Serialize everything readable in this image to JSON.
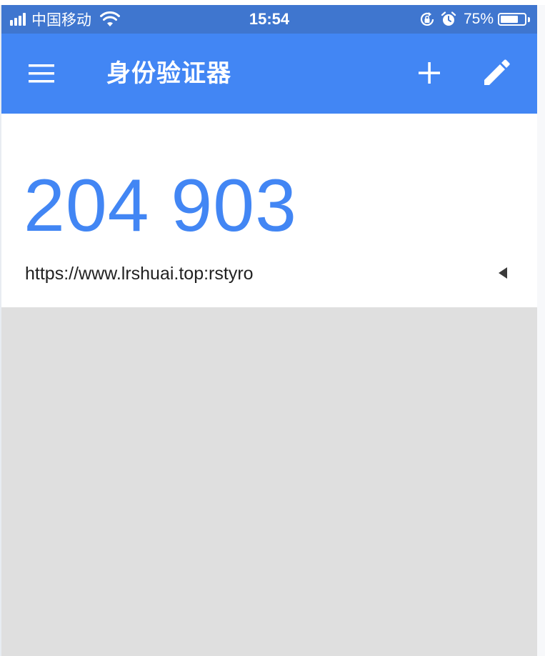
{
  "status_bar": {
    "carrier": "中国移动",
    "time": "15:54",
    "battery_percent": "75%",
    "battery_level": 0.75,
    "icons": [
      "signal-icon",
      "wifi-icon",
      "rotation-lock-icon",
      "alarm-icon",
      "battery-icon"
    ]
  },
  "app_bar": {
    "title": "身份验证器",
    "icons": [
      "menu-icon",
      "add-icon",
      "edit-icon"
    ]
  },
  "accounts": [
    {
      "code": "204 903",
      "name": "https://www.lrshuai.top:rstyro",
      "indicator_icon": "countdown-timer-icon"
    }
  ],
  "colors": {
    "status_bar": "#3f76cf",
    "app_bar": "#4286f4",
    "code_text": "#4286f4",
    "background": "#dfdfdf",
    "card": "#ffffff"
  }
}
